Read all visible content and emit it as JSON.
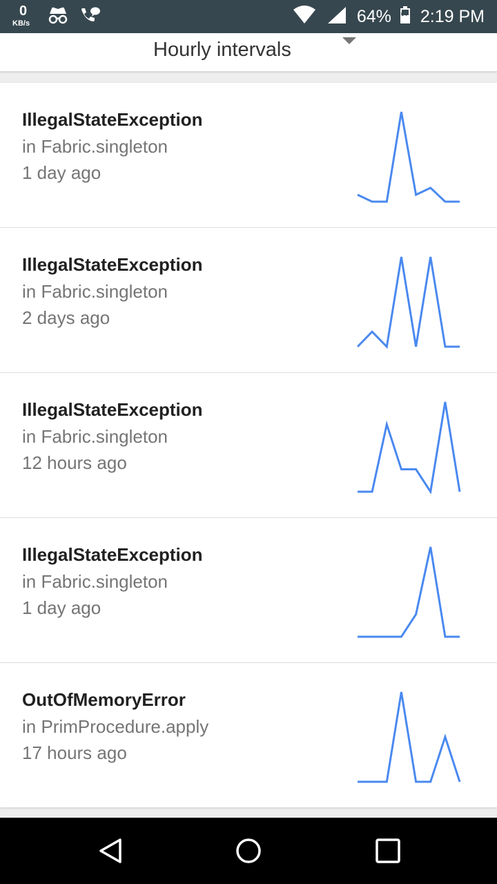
{
  "status_bar": {
    "net_speed_value": "0",
    "net_speed_unit": "KB/s",
    "icons": [
      "incognito-icon",
      "wifi-call-icon",
      "wifi-icon",
      "signal-icon",
      "battery-icon"
    ],
    "battery": "64%",
    "battery_icon_label": "64",
    "time": "2:19 PM"
  },
  "header": {
    "interval_label": "Hourly intervals",
    "icon": "dropdown-arrow-icon"
  },
  "issues": [
    {
      "title": "IllegalStateException",
      "location": "in Fabric.singleton",
      "time": "1 day ago",
      "trend": [
        1,
        0,
        0,
        13,
        1,
        2,
        0,
        0
      ]
    },
    {
      "title": "IllegalStateException",
      "location": "in Fabric.singleton",
      "time": "2 days ago",
      "trend": [
        0,
        1,
        0,
        6,
        0,
        6,
        0,
        0
      ]
    },
    {
      "title": "IllegalStateException",
      "location": "in Fabric.singleton",
      "time": "12 hours ago",
      "trend": [
        0,
        0,
        3,
        1,
        1,
        0,
        4,
        0
      ]
    },
    {
      "title": "IllegalStateException",
      "location": "in Fabric.singleton",
      "time": "1 day ago",
      "trend": [
        0,
        0,
        0,
        0,
        1,
        4,
        0,
        0
      ]
    },
    {
      "title": "OutOfMemoryError",
      "location": "in PrimProcedure.apply",
      "time": "17 hours ago",
      "trend": [
        0,
        0,
        0,
        4,
        0,
        0,
        2,
        0
      ]
    }
  ],
  "nav_bar": {
    "icons": [
      "back-icon",
      "home-icon",
      "recents-icon"
    ]
  },
  "colors": {
    "accent": "#4a89f0",
    "status_bar": "#37474f",
    "nav_bar": "#000000"
  }
}
